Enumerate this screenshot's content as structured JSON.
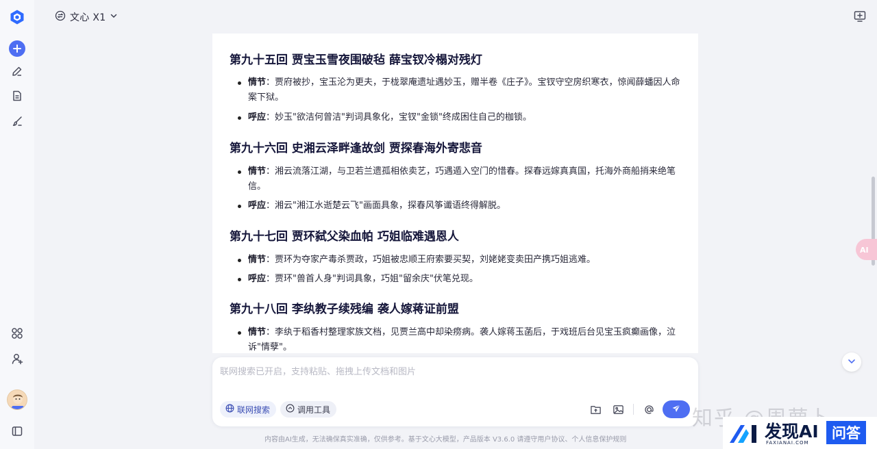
{
  "header": {
    "model_name": "文心 X1"
  },
  "sections": [
    {
      "title": "第九十五回 贾宝玉雪夜围破毡 薛宝钗冷榻对残灯",
      "items": [
        {
          "label": "情节",
          "text": "：贾府被抄，宝玉沦为更夫，于栊翠庵遗址遇妙玉，赠半卷《庄子》。宝钗守空房织寒衣，惊闻薛蟠因人命案下狱。"
        },
        {
          "label": "呼应",
          "text": "：妙玉\"欲洁何曾洁\"判词具象化，宝钗\"金锁\"终成困住自己的枷锁。"
        }
      ]
    },
    {
      "title": "第九十六回 史湘云泽畔逢故剑 贾探春海外寄悲音",
      "items": [
        {
          "label": "情节",
          "text": "：湘云流落江湖，与卫若兰遗孤相依卖艺，巧遇遁入空门的惜春。探春远嫁真真国，托海外商船捎来绝笔信。"
        },
        {
          "label": "呼应",
          "text": "：湘云\"湘江水逝楚云飞\"画面具象，探春风筝谶语终得解脱。"
        }
      ]
    },
    {
      "title": "第九十七回 贾环弑父染血帕 巧姐临难遇恩人",
      "items": [
        {
          "label": "情节",
          "text": "：贾环为夺家产毒杀贾政，巧姐被忠顺王府索要买契，刘姥姥变卖田产携巧姐逃难。"
        },
        {
          "label": "呼应",
          "text": "：贾环\"兽首人身\"判词具象，巧姐\"留余庆\"伏笔兑现。"
        }
      ]
    },
    {
      "title": "第九十八回 李纨教子续残编 袭人嫁蒋证前盟",
      "items": [
        {
          "label": "情节",
          "text": "：李纨于稻香村整理家族文档，见贾兰高中却染痨病。袭人嫁蒋玉菡后，于戏班后台见宝玉疯癫画像，泣诉\"情孽\"。"
        }
      ]
    }
  ],
  "composer": {
    "placeholder": "联网搜索已开启，支持粘贴、拖拽上传文档和图片",
    "web_search_label": "联网搜索",
    "tools_label": "调用工具"
  },
  "footer": {
    "text": "内容由AI生成，无法确保真实准确，仅供参考。基于文心大模型，产品版本 V3.6.0 请遵守用户协议、个人信息保护规则"
  },
  "watermark": {
    "zhihu_text": "知乎 @周萝卜",
    "brand_text": "发现AI",
    "brand_sub": "FAXIANAI.COM",
    "qa_text": "问答"
  },
  "colors": {
    "accent": "#4e6ef2",
    "background": "#f2f3f7",
    "card": "#ffffff"
  }
}
